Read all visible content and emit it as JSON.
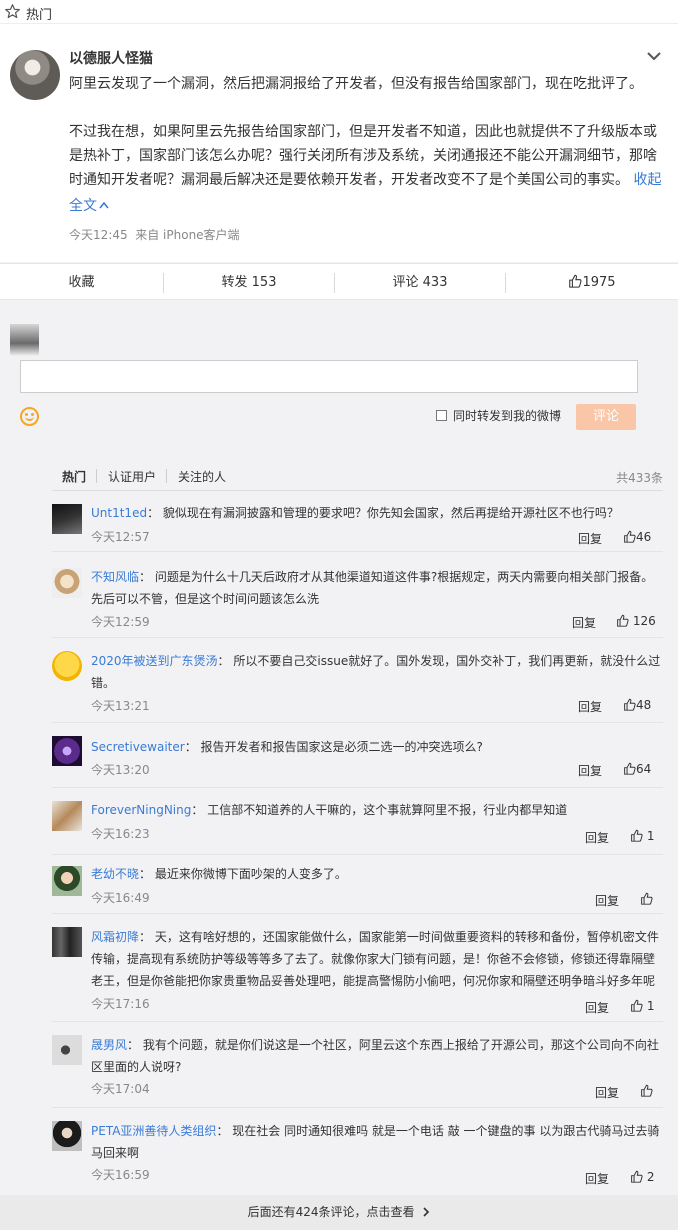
{
  "topbar": {
    "label": "热门",
    "icon": "star-icon"
  },
  "post": {
    "author": "以德服人怪猫",
    "para1": "阿里云发现了一个漏洞，然后把漏洞报给了开发者，但没有报告给国家部门，现在吃批评了。",
    "para2": "不过我在想，如果阿里云先报告给国家部门，但是开发者不知道，因此也就提供不了升级版本或是热补丁，国家部门该怎么办呢？强行关闭所有涉及系统，关闭通报还不能公开漏洞细节，那啥时通知开发者呢？漏洞最后解决还是要依赖开发者，开发者改变不了是个美国公司的事实。",
    "collapse": "收起",
    "fulltext": "全文",
    "time": "今天12:45",
    "source": "来自 iPhone客户端"
  },
  "actions": {
    "favorite": "收藏",
    "repost": "转发 153",
    "comment": "评论 433",
    "like": "1975"
  },
  "compose": {
    "repost_label": "同时转发到我的微博",
    "submit": "评论"
  },
  "comments": {
    "tabs": [
      "热门",
      "认证用户",
      "关注的人"
    ],
    "total": "共433条",
    "items": [
      {
        "name": "Unt1t1ed",
        "text": "貌似现在有漏洞披露和管理的要求吧？你先知会国家，然后再提给开源社区不也行吗？",
        "time": "今天12:57",
        "reply": "回复",
        "likes": "46"
      },
      {
        "name": "不知风临",
        "text": "问题是为什么十几天后政府才从其他渠道知道这件事?根据规定，两天内需要向相关部门报备。先后可以不管，但是这个时间问题该怎么洗",
        "time": "今天12:59",
        "reply": "回复",
        "likes": "126"
      },
      {
        "name": "2020年被送到广东煲汤",
        "text": "所以不要自己交issue就好了。国外发现，国外交补丁，我们再更新，就没什么过错。",
        "time": "今天13:21",
        "reply": "回复",
        "likes": "48"
      },
      {
        "name": "Secretivewaiter",
        "text": "报告开发者和报告国家这是必须二选一的冲突选项么?",
        "time": "今天13:20",
        "reply": "回复",
        "likes": "64"
      },
      {
        "name": "ForeverNingNing",
        "text": "工信部不知道养的人干嘛的，这个事就算阿里不报，行业内都早知道",
        "time": "今天16:23",
        "reply": "回复",
        "likes": "1"
      },
      {
        "name": "老幼不晓",
        "text": "最近来你微博下面吵架的人变多了。",
        "time": "今天16:49",
        "reply": "回复",
        "likes": ""
      },
      {
        "name": "风霜初降",
        "text": "天，这有啥好想的，还国家能做什么，国家能第一时间做重要资料的转移和备份，暂停机密文件传输，提高现有系统防护等级等等多了去了。就像你家大门锁有问题，是！你爸不会修锁，修锁还得靠隔壁老王，但是你爸能把你家贵重物品妥善处理吧，能提高警惕防小偷吧，何况你家和隔壁还明争暗斗好多年呢",
        "time": "今天17:16",
        "reply": "回复",
        "likes": "1"
      },
      {
        "name": "晟男风",
        "text": "我有个问题，就是你们说这是一个社区，阿里云这个东西上报给了开源公司，那这个公司向不向社区里面的人说呀?",
        "time": "今天17:04",
        "reply": "回复",
        "likes": ""
      },
      {
        "name": "PETA亚洲善待人类组织",
        "text": "现在社会 同时通知很难吗 就是一个电话 敲 一个键盘的事 以为跟古代骑马过去骑马回来啊",
        "time": "今天16:59",
        "reply": "回复",
        "likes": "2"
      }
    ]
  },
  "footer": {
    "more": "后面还有424条评论，点击查看"
  },
  "colors": {
    "link": "#3a7bd5",
    "accent_button": "#f9c6a8",
    "emoji": "#f5a623"
  }
}
